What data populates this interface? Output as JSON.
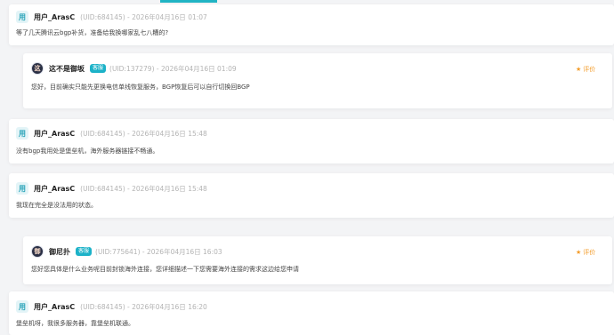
{
  "comments": [
    {
      "avatar": "用",
      "name": "用户_ArasC",
      "meta": "(UID:684145) - 2026年04月16日 01:07",
      "content": "等了几天腾讯云bgp补货，准备给我换哪家乱七八糟的?"
    },
    {
      "avatar": "这",
      "name": "这不是御坂",
      "badge": "客服",
      "meta": "(UID:137279) - 2026年04月16日 01:09",
      "content": "您好，目前确实只能先更换电信单线恢复服务，BGP恢复后可以自行切换回BGP",
      "rate_label": "评价"
    },
    {
      "avatar": "用",
      "name": "用户_ArasC",
      "meta": "(UID:684145) - 2026年04月16日 15:48",
      "content": "没有bgp我用处是堡垒机，海外服务器链接不畅通。"
    },
    {
      "avatar": "用",
      "name": "用户_ArasC",
      "meta": "(UID:684145) - 2026年04月16日 15:48",
      "content": "我现在完全是没法用的状态。"
    },
    {
      "avatar": "御",
      "name": "御尼扑",
      "badge": "客服",
      "meta": "(UID:775641) - 2026年04月16日 16:03",
      "content": "您好您具体是什么业务呢目前封锁海外连接，您详细描述一下您需要海外连接的需求这边给您申请",
      "rate_label": "评价"
    },
    {
      "avatar": "用",
      "name": "用户_ArasC",
      "meta": "(UID:684145) - 2026年04月16日 16:20",
      "content": "堡垒机呀，我很多服务器，靠堡垒机联通。"
    }
  ],
  "colors": {
    "accent": "#1cb2c8",
    "rate": "#f39c2a"
  }
}
